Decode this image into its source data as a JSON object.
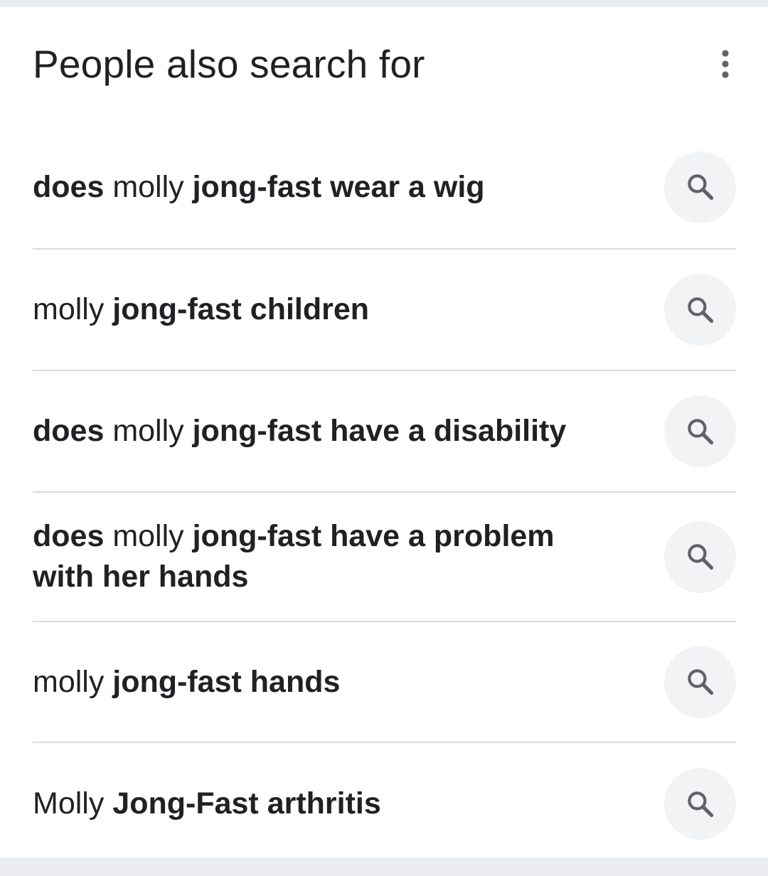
{
  "header": {
    "title": "People also search for",
    "more_icon": "more-vert-icon"
  },
  "suggestions": [
    {
      "parts": [
        {
          "text": "does",
          "bold": true
        },
        {
          "text": " molly ",
          "bold": false
        },
        {
          "text": "jong-fast wear a wig",
          "bold": true
        }
      ],
      "icon": "search-icon"
    },
    {
      "parts": [
        {
          "text": "molly ",
          "bold": false
        },
        {
          "text": "jong-fast children",
          "bold": true
        }
      ],
      "icon": "search-icon"
    },
    {
      "parts": [
        {
          "text": "does",
          "bold": true
        },
        {
          "text": " molly ",
          "bold": false
        },
        {
          "text": "jong-fast have a disability",
          "bold": true
        }
      ],
      "icon": "search-icon"
    },
    {
      "parts": [
        {
          "text": "does",
          "bold": true
        },
        {
          "text": " molly ",
          "bold": false
        },
        {
          "text": "jong-fast have a problem with her hands",
          "bold": true
        }
      ],
      "icon": "search-icon"
    },
    {
      "parts": [
        {
          "text": "molly ",
          "bold": false
        },
        {
          "text": "jong-fast hands",
          "bold": true
        }
      ],
      "icon": "search-icon"
    },
    {
      "parts": [
        {
          "text": "Molly ",
          "bold": false
        },
        {
          "text": "Jong-Fast arthritis",
          "bold": true
        }
      ],
      "icon": "search-icon"
    }
  ],
  "colors": {
    "text": "#202124",
    "icon": "#5f6368",
    "divider": "#dadce0",
    "button_bg": "#f1f3f4",
    "page_bg": "#ebecef"
  }
}
